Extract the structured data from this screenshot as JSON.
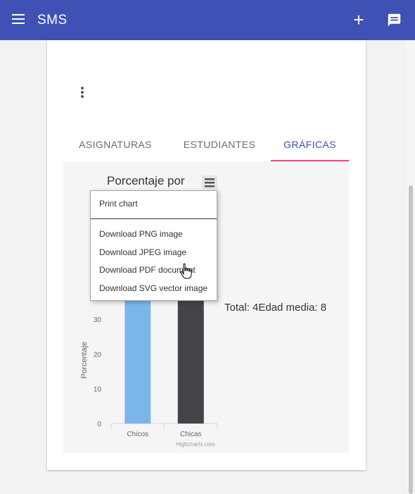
{
  "app": {
    "title": "SMS"
  },
  "tabs": [
    {
      "label": "ASIGNATURAS",
      "active": false
    },
    {
      "label": "ESTUDIANTES",
      "active": false
    },
    {
      "label": "GRÁFICAS",
      "active": true
    }
  ],
  "chart_menu": {
    "items": [
      "Print chart",
      "Download PNG image",
      "Download JPEG image",
      "Download PDF document",
      "Download SVG vector image"
    ]
  },
  "chart_data": {
    "type": "bar",
    "title": "Porcentaje por",
    "ylabel": "Porcentaje",
    "categories": [
      "Chicos",
      "Chicas"
    ],
    "series": [
      {
        "values": [
          50,
          50
        ]
      }
    ],
    "colors": [
      "#7cb5ec",
      "#434348"
    ],
    "ylim": [
      0,
      60
    ],
    "yticks": [
      "0",
      "10",
      "20",
      "30"
    ],
    "credits": "Highcharts.com",
    "annotation": "Total: 4Edad media: 8"
  }
}
